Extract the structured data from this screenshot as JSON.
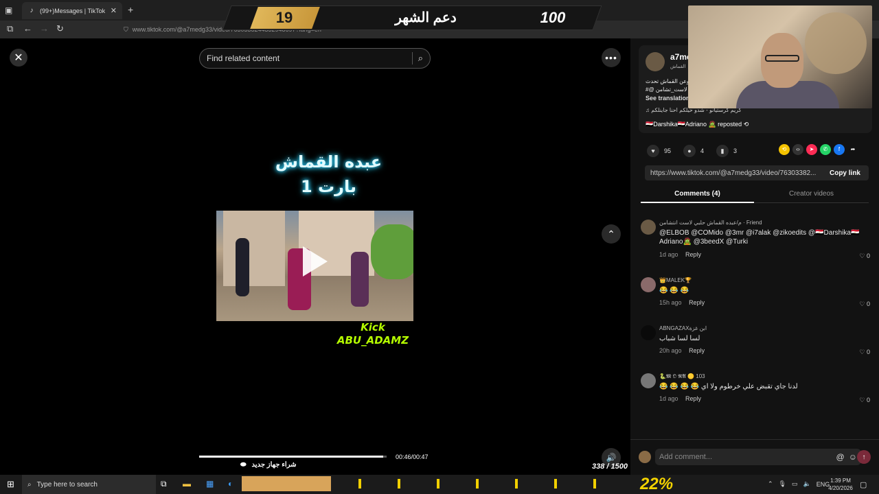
{
  "browser": {
    "tab_title": "(99+)Messages | TikTok",
    "url": "www.tiktok.com/@a7medg33/video/7630338244332948697?lang=en"
  },
  "overlay": {
    "left_number": "19",
    "title": "دعم الشهر",
    "right_number": "100"
  },
  "player": {
    "search_placeholder": "Find related content",
    "video_title_line1": "عبده القماش",
    "video_title_line2": "بارت 1",
    "kick_line1": "Kick",
    "kick_line2": "ABU_ADAMZ",
    "progress_fraction": 0.98,
    "time": "00:46/00:47",
    "promo_text": "شراء جهاز جديد",
    "counter": "338 / 1500"
  },
  "author": {
    "name": "a7me",
    "sub": "القماش",
    "desc_line1": "وعن القماش تحدث",
    "desc_line2": "#@ لاست_تشامن",
    "see_translation": "See translation",
    "music": "كريم كرستيانو - شدو حيلكم احنا جاينلكم",
    "repost": "🇪🇬Darshika🇪🇬Adriano 🧟 reposted"
  },
  "actions": {
    "likes": "95",
    "comments": "4",
    "saves": "3"
  },
  "share": {
    "link": "https://www.tiktok.com/@a7medg33/video/76303382...",
    "copy_label": "Copy link"
  },
  "tabs": {
    "comments": "Comments (4)",
    "creator_videos": "Creator videos"
  },
  "comments": [
    {
      "name": "م/عبده القماش حلبي لاست انتشامن · Friend",
      "text": "@ELBOB @COMido @3mr @i7alak @zikoedits @🇪🇬Darshika🇪🇬Adriano🧟 @3beedX @Turki",
      "time": "1d ago",
      "reply": "Reply",
      "likes": "0"
    },
    {
      "name": "👑MALEK🏆",
      "text": "😂 😂 😂",
      "time": "15h ago",
      "reply": "Reply",
      "likes": "0"
    },
    {
      "name": "ABNGAZAXابن غزة",
      "text": "لسا لسا شباب",
      "time": "20h ago",
      "reply": "Reply",
      "likes": "0"
    },
    {
      "name": "🐍𝕸 𝕺 𝕽𝕬 🟡 103",
      "text": "😂 😂 😂 😂 لدنا جاي تقبض علي خرطوم ولا اي",
      "time": "1d ago",
      "reply": "Reply",
      "likes": "0"
    }
  ],
  "add_comment": {
    "placeholder": "Add comment..."
  },
  "taskbar": {
    "search_placeholder": "Type here to search",
    "percent": "22%",
    "language": "ENG",
    "time": "1:39 PM",
    "date": "4/20/2026"
  }
}
